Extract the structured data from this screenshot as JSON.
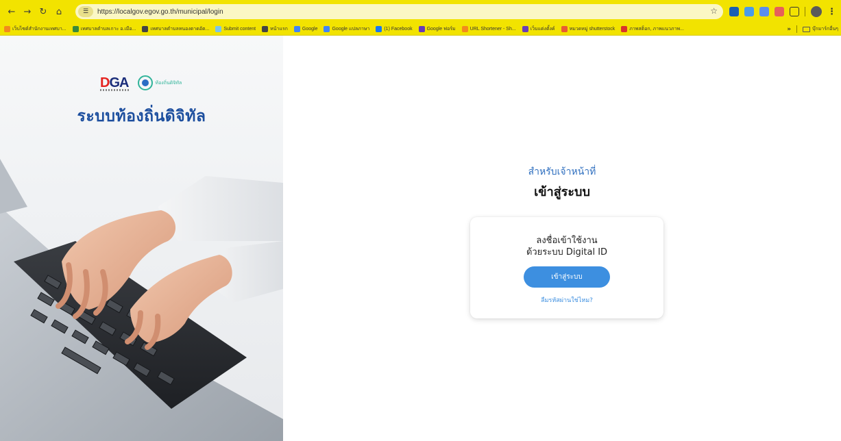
{
  "browser": {
    "url": "https://localgov.egov.go.th/municipal/login",
    "bookmarks": [
      {
        "label": "เว็บไซต์สำนักงานเทศบา...",
        "color": "#f28b1d"
      },
      {
        "label": "เทศบาลตำบลเกาะ อ.เมือ...",
        "color": "#3a8a3a"
      },
      {
        "label": "เทศบาลตำบลหนองตาดอัต...",
        "color": "#444444"
      },
      {
        "label": "Submit content",
        "color": "#7cc4e8"
      },
      {
        "label": "หน้าแรก",
        "color": "#444444"
      },
      {
        "label": "Google",
        "color": "#4285f4"
      },
      {
        "label": "Google แปลภาษา",
        "color": "#4285f4"
      },
      {
        "label": "(1) Facebook",
        "color": "#1877f2"
      },
      {
        "label": "Google ฟอร์ม",
        "color": "#673ab7"
      },
      {
        "label": "URL Shortener - Sh...",
        "color": "#f28b1d"
      },
      {
        "label": "เว็บแต่งตั้งค์",
        "color": "#6a3fb5"
      },
      {
        "label": "หมวดหมู่ shutterstock",
        "color": "#e85c33"
      },
      {
        "label": "ภาพสต็อก, ภาพแนวภาพ...",
        "color": "#d9342b"
      }
    ],
    "other_bookmarks": "บุ๊กมาร์กอื่นๆ",
    "more_label": "»"
  },
  "left": {
    "dga_letters": [
      "D",
      "G",
      "A"
    ],
    "local_logo_text": "ท้องถิ่นดิจิทัล",
    "system_title": "ระบบท้องถิ่นดิจิทัล"
  },
  "login": {
    "for_staff": "สำหรับเจ้าหน้าที่",
    "title": "เข้าสู่ระบบ",
    "card_line1": "ลงชื่อเข้าใช้งาน",
    "card_line2": "ด้วยระบบ Digital ID",
    "login_button": "เข้าสู่ระบบ",
    "forgot_password": "ลืมรหัสผ่านใช่ไหม?"
  },
  "colors": {
    "chrome": "#f2e300",
    "accent": "#3d8fe0",
    "title_blue": "#1c4e9e"
  }
}
